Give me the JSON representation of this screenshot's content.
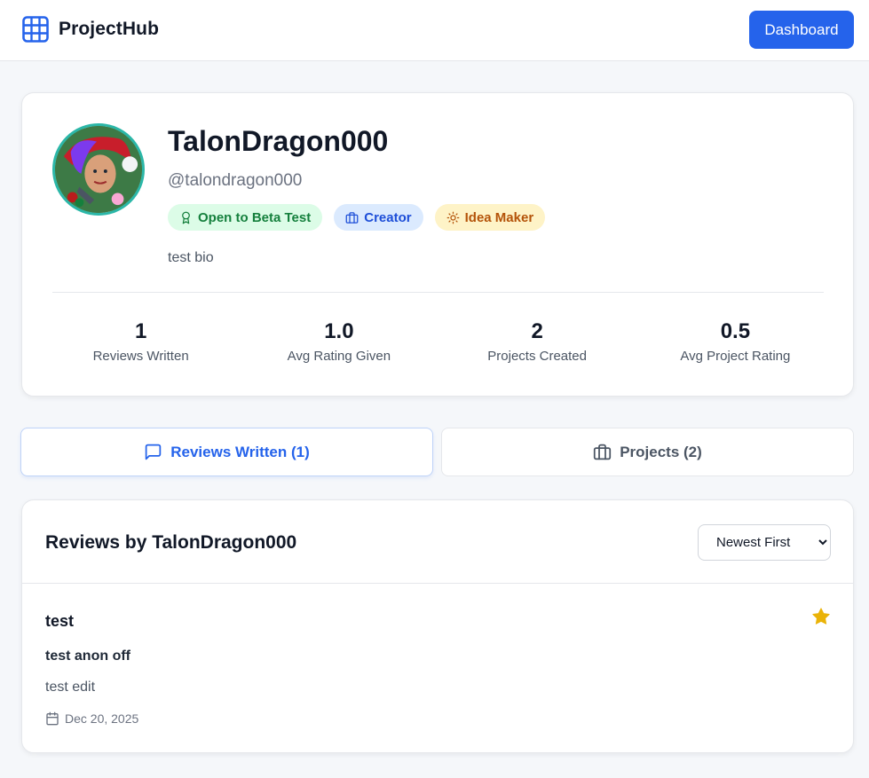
{
  "header": {
    "brand": "ProjectHub",
    "dashboard_label": "Dashboard",
    "brand_icon": "grid-icon"
  },
  "profile": {
    "name": "TalonDragon000",
    "handle": "@talondragon000",
    "bio": "test bio",
    "badges": [
      {
        "label": "Open to Beta Test",
        "icon": "award-icon",
        "color": "#15803d"
      },
      {
        "label": "Creator",
        "icon": "briefcase-icon",
        "color": "#1d4ed8"
      },
      {
        "label": "Idea Maker",
        "icon": "sun-icon",
        "color": "#b45309"
      }
    ],
    "stats": [
      {
        "value": "1",
        "label": "Reviews Written"
      },
      {
        "value": "1.0",
        "label": "Avg Rating Given"
      },
      {
        "value": "2",
        "label": "Projects Created"
      },
      {
        "value": "0.5",
        "label": "Avg Project Rating"
      }
    ]
  },
  "tabs": [
    {
      "label": "Reviews Written (1)",
      "icon": "message-square-icon",
      "active": true
    },
    {
      "label": "Projects (2)",
      "icon": "briefcase-icon",
      "active": false
    }
  ],
  "reviews": {
    "title": "Reviews by TalonDragon000",
    "sort_selected": "Newest First",
    "items": [
      {
        "title": "test",
        "subtitle": "test anon off",
        "body": "test edit",
        "date": "Dec 20, 2025",
        "rating": 1
      }
    ]
  },
  "colors": {
    "accent": "#2563eb",
    "star": "#eab308",
    "background": "#f5f7fa"
  }
}
